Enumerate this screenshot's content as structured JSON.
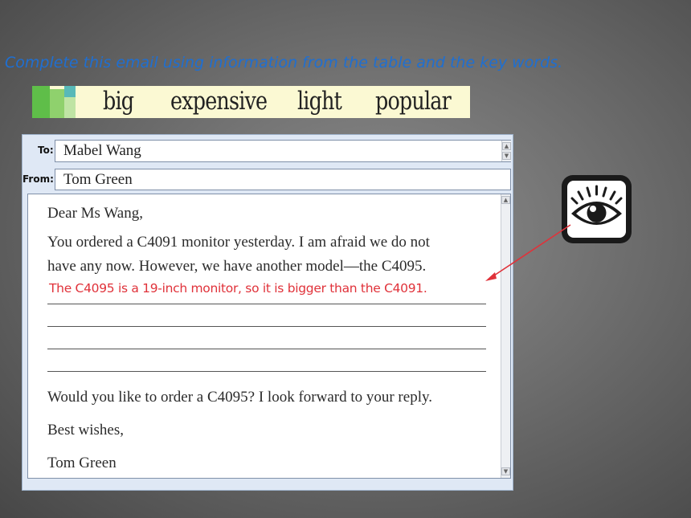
{
  "instruction": "Complete this email using information from the table and the key words.",
  "keywords": [
    "big",
    "expensive",
    "light",
    "popular"
  ],
  "email": {
    "to_label": "To:",
    "to_value": "Mabel Wang",
    "from_label": "From:",
    "from_value": "Tom Green",
    "greeting": "Dear Ms Wang,",
    "line1": "You ordered a C4091 monitor yesterday. I am afraid we do not",
    "line2": "have any now. However, we have another model—the C4095.",
    "answer": "The C4095 is a 19-inch monitor, so it is bigger than the C4091.",
    "closing_question": "Would you like to order a C4095? I look forward to your reply.",
    "sign_off": "Best wishes,",
    "signature": "Tom Green"
  },
  "colors": {
    "instruction": "#1f6fd1",
    "answer": "#e0323a",
    "arrow": "#e0323a"
  },
  "icons": {
    "hint": "eye-icon"
  }
}
